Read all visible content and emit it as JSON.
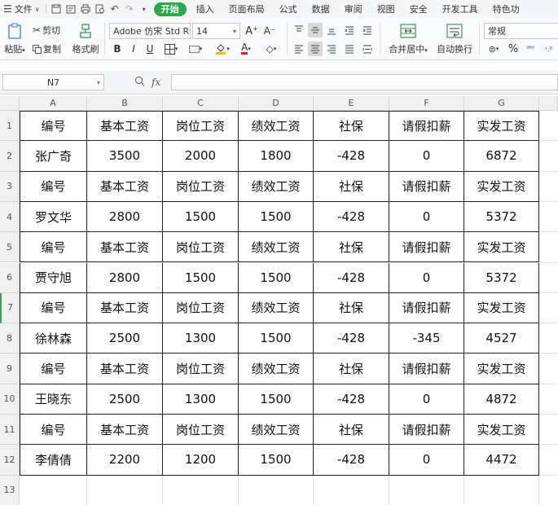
{
  "menubar": {
    "file_label": "文件",
    "tabs": [
      "开始",
      "插入",
      "页面布局",
      "公式",
      "数据",
      "审阅",
      "视图",
      "安全",
      "开发工具",
      "特色功"
    ],
    "active_tab": "开始"
  },
  "ribbon": {
    "paste_label": "粘贴",
    "cut_label": "剪切",
    "copy_label": "复制",
    "format_painter_label": "格式刷",
    "font_name": "Adobe 仿宋 Std R",
    "font_size": "14",
    "merge_label": "合并居中",
    "wrap_label": "自动换行",
    "number_format": "常规",
    "bold": "B",
    "italic": "I",
    "underline": "U",
    "percent": "%"
  },
  "formula_bar": {
    "name_box": "N7",
    "fx": "fx",
    "formula": ""
  },
  "sheet": {
    "columns": [
      "A",
      "B",
      "C",
      "D",
      "E",
      "F",
      "G"
    ],
    "rows": [
      "1",
      "2",
      "3",
      "4",
      "5",
      "6",
      "7",
      "8",
      "9",
      "10",
      "11",
      "12",
      "13"
    ],
    "active_row": "7",
    "cells": [
      [
        "编号",
        "基本工资",
        "岗位工资",
        "绩效工资",
        "社保",
        "请假扣薪",
        "实发工资"
      ],
      [
        "张广奇",
        "3500",
        "2000",
        "1800",
        "-428",
        "0",
        "6872"
      ],
      [
        "编号",
        "基本工资",
        "岗位工资",
        "绩效工资",
        "社保",
        "请假扣薪",
        "实发工资"
      ],
      [
        "罗文华",
        "2800",
        "1500",
        "1500",
        "-428",
        "0",
        "5372"
      ],
      [
        "编号",
        "基本工资",
        "岗位工资",
        "绩效工资",
        "社保",
        "请假扣薪",
        "实发工资"
      ],
      [
        "贾守旭",
        "2800",
        "1500",
        "1500",
        "-428",
        "0",
        "5372"
      ],
      [
        "编号",
        "基本工资",
        "岗位工资",
        "绩效工资",
        "社保",
        "请假扣薪",
        "实发工资"
      ],
      [
        "徐林森",
        "2500",
        "1300",
        "1500",
        "-428",
        "-345",
        "4527"
      ],
      [
        "编号",
        "基本工资",
        "岗位工资",
        "绩效工资",
        "社保",
        "请假扣薪",
        "实发工资"
      ],
      [
        "王晓东",
        "2500",
        "1300",
        "1500",
        "-428",
        "0",
        "4872"
      ],
      [
        "编号",
        "基本工资",
        "岗位工资",
        "绩效工资",
        "社保",
        "请假扣薪",
        "实发工资"
      ],
      [
        "李倩倩",
        "2200",
        "1200",
        "1500",
        "-428",
        "0",
        "4472"
      ]
    ]
  },
  "colors": {
    "accent_green": "#2aa84a",
    "border": "#222222"
  }
}
